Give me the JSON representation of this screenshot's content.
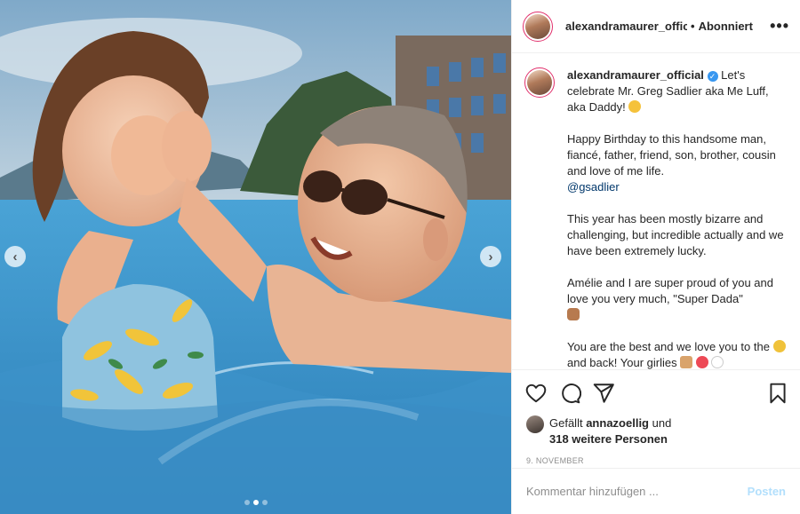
{
  "header": {
    "username": "alexandramaurer_offic",
    "separator": "•",
    "follow_status": "Abonniert",
    "more_icon": "more-horizontal-icon"
  },
  "caption": {
    "username": "alexandramaurer_official",
    "verified_icon": "verified-badge-icon",
    "intro": "Let's celebrate Mr. Greg Sadlier aka Me Luff, aka Daddy!",
    "p1": "Happy Birthday to this handsome man, fiancé, father, friend, son, brother, cousin and love of me life.",
    "mention": "@gsadlier",
    "p2": "This year has been mostly bizarre and challenging, but incredible actually and we have been extremely lucky.",
    "p3": "Amélie and I are super proud of you and love you very much, \"Super Dada\"",
    "p4a": "You are the best and we love you to",
    "p4b": "the",
    "p4c": "and back! Your girlies"
  },
  "actions": {
    "like_icon": "heart-icon",
    "comment_icon": "comment-icon",
    "share_icon": "paper-plane-icon",
    "save_icon": "bookmark-icon"
  },
  "likes": {
    "prefix": "Gefällt",
    "user": "annazoellig",
    "conj": "und",
    "others": "318 weitere Personen"
  },
  "date": "9. NOVEMBER",
  "comment_input": {
    "placeholder": "Kommentar hinzufügen ...",
    "post_label": "Posten"
  },
  "media": {
    "prev_label": "‹",
    "next_label": "›",
    "carousel_count": 3,
    "carousel_active": 1
  },
  "colors": {
    "accent": "#3897f0",
    "post_disabled": "#b2dffc",
    "story_ring": "#e1306c",
    "mention": "#00376b",
    "muted": "#8e8e8e"
  }
}
